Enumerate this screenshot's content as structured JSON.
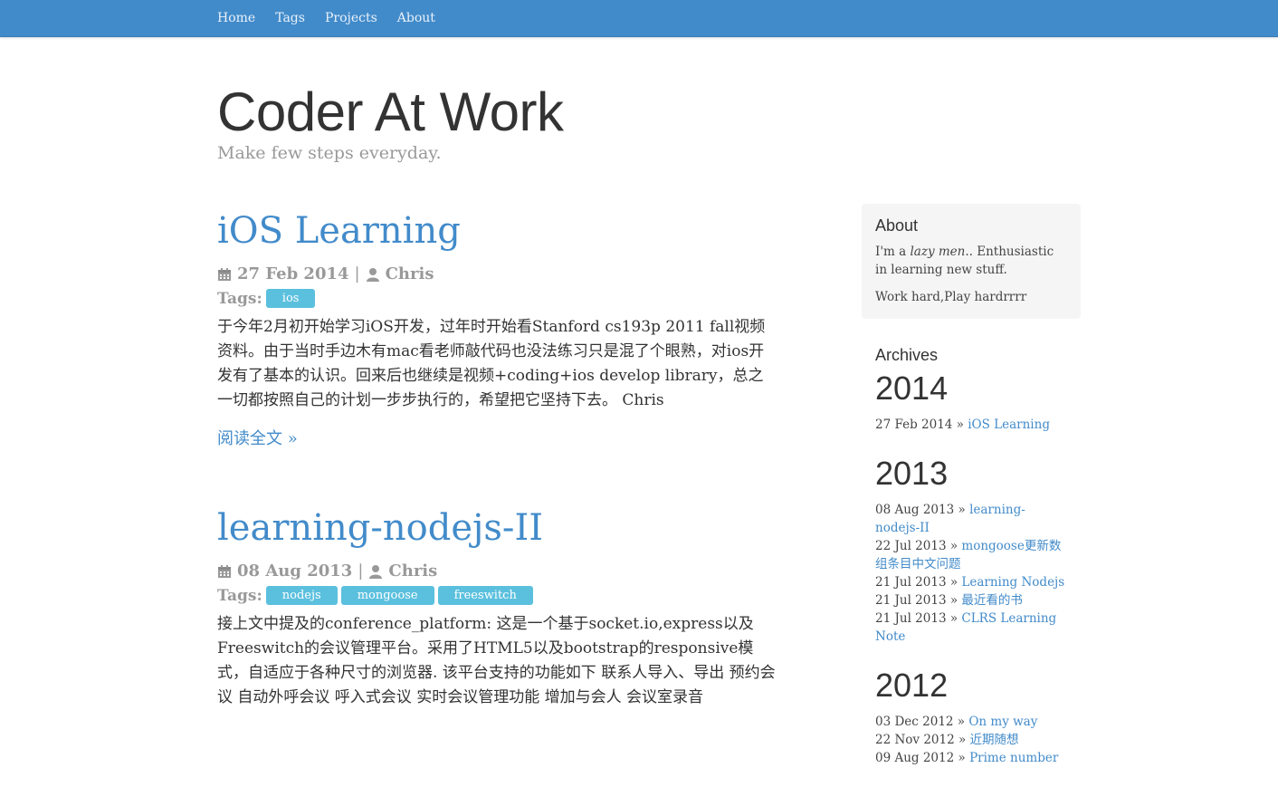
{
  "nav": {
    "items": [
      "Home",
      "Tags",
      "Projects",
      "About"
    ]
  },
  "header": {
    "title": "Coder At Work",
    "subtitle": "Make few steps everyday."
  },
  "posts": [
    {
      "title": "iOS Learning",
      "date": "27 Feb 2014",
      "author": "Chris",
      "tags_label": "Tags:",
      "tags": [
        "ios"
      ],
      "excerpt": "于今年2月初开始学习iOS开发，过年时开始看Stanford cs193p 2011 fall视频资料。由于当时手边木有mac看老师敲代码也没法练习只是混了个眼熟，对ios开发有了基本的认识。回来后也继续是视频+coding+ios develop library，总之一切都按照自己的计划一步步执行的，希望把它坚持下去。 Chris",
      "read_more": "阅读全文 »"
    },
    {
      "title": "learning-nodejs-II",
      "date": "08 Aug 2013",
      "author": "Chris",
      "tags_label": "Tags:",
      "tags": [
        "nodejs",
        "mongoose",
        "freeswitch"
      ],
      "excerpt": "接上文中提及的conference_platform: 这是一个基于socket.io,express以及Freeswitch的会议管理平台。采用了HTML5以及bootstrap的responsive模式，自适应于各种尺寸的浏览器. 该平台支持的功能如下 联系人导入、导出 预约会议 自动外呼会议 呼入式会议 实时会议管理功能 增加与会人 会议室录音"
    }
  ],
  "sidebar": {
    "about": {
      "heading": "About",
      "line1_prefix": "I'm a ",
      "line1_em": "lazy men",
      "line1_suffix": ".. Enthusiastic in learning new stuff.",
      "line2": "Work hard,Play hardrrrr"
    },
    "archives": {
      "heading": "Archives",
      "years": [
        {
          "year": "2014",
          "entries": [
            {
              "date": "27 Feb 2014 »",
              "title": "iOS Learning"
            }
          ]
        },
        {
          "year": "2013",
          "entries": [
            {
              "date": "08 Aug 2013 »",
              "title": "learning-nodejs-II"
            },
            {
              "date": "22 Jul 2013 »",
              "title": "mongoose更新数组条目中文问题"
            },
            {
              "date": "21 Jul 2013 »",
              "title": "Learning Nodejs"
            },
            {
              "date": "21 Jul 2013 »",
              "title": "最近看的书"
            },
            {
              "date": "21 Jul 2013 »",
              "title": "CLRS Learning Note"
            }
          ]
        },
        {
          "year": "2012",
          "entries": [
            {
              "date": "03 Dec 2012 »",
              "title": "On my way"
            },
            {
              "date": "22 Nov 2012 »",
              "title": "近期随想"
            },
            {
              "date": "09 Aug 2012 »",
              "title": "Prime number"
            }
          ]
        }
      ]
    }
  },
  "colors": {
    "navbar": "#428bca",
    "link": "#428bca",
    "tag": "#5bc0de",
    "muted": "#999999"
  }
}
